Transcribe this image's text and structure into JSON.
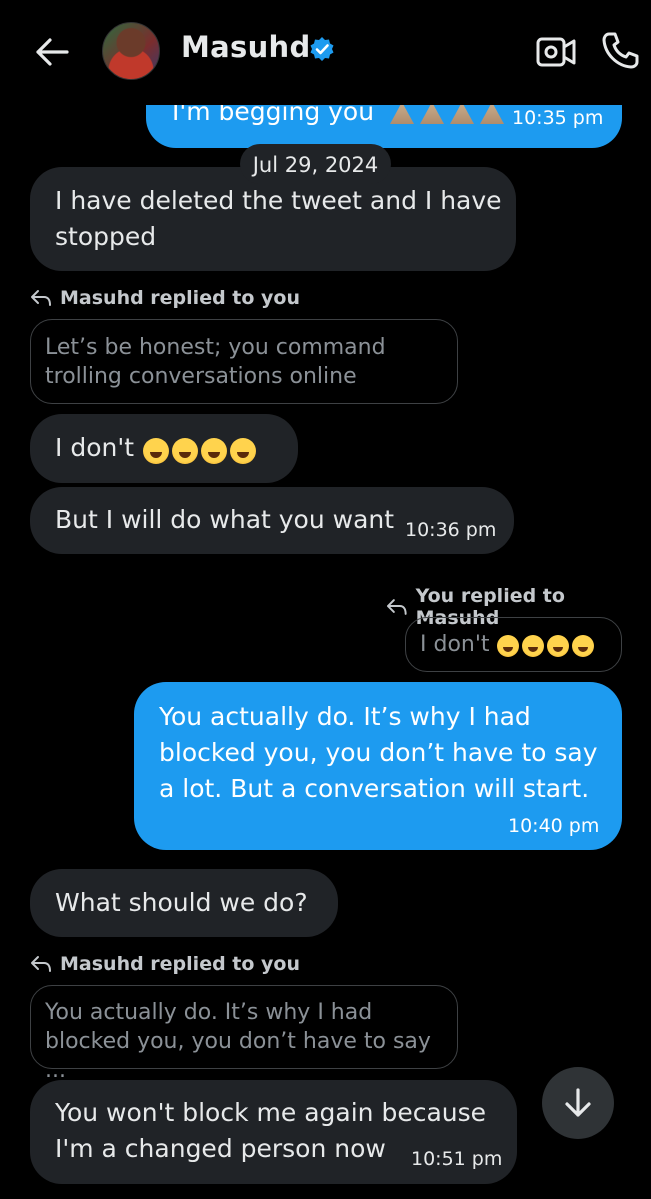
{
  "header": {
    "contact_name": "Masuhd",
    "back_icon": "arrow-left-icon",
    "verified_icon": "verified-badge-icon",
    "video_icon": "video-call-icon",
    "call_icon": "phone-icon"
  },
  "messages": {
    "m0": {
      "text": "I'm begging you",
      "time": "10:35 pm"
    },
    "date_separator": "Jul 29, 2024",
    "m1": {
      "text_line1": "I have deleted the tweet and I have",
      "text_line2": "stopped"
    },
    "reply1": {
      "label": "Masuhd replied to you",
      "quote_line1": "Let’s be honest; you command",
      "quote_line2": "trolling conversations online"
    },
    "m2": {
      "text": "I don't"
    },
    "m3": {
      "text": "But I will do what you want",
      "time": "10:36 pm"
    },
    "reply2": {
      "label": "You replied to Masuhd",
      "quote": "I don't"
    },
    "m4": {
      "line1": "You actually do. It’s why I had",
      "line2": "blocked you, you don’t have to say",
      "line3": "a lot. But a conversation will start.",
      "time": "10:40 pm"
    },
    "m5": {
      "text": "What should we  do?"
    },
    "reply3": {
      "label": "Masuhd replied to you",
      "quote_line1": "You actually do. It’s why I had",
      "quote_line2": "blocked you, you don’t have to say ..."
    },
    "m6": {
      "line1": "You won't block me again because",
      "line2": "I'm a changed person now",
      "time": "10:51 pm"
    }
  },
  "controls": {
    "scroll_down_icon": "arrow-down-icon"
  },
  "colors": {
    "background": "#000000",
    "incoming_bubble": "#202327",
    "outgoing_bubble": "#1d9bf0",
    "verified": "#1d9bf0"
  }
}
